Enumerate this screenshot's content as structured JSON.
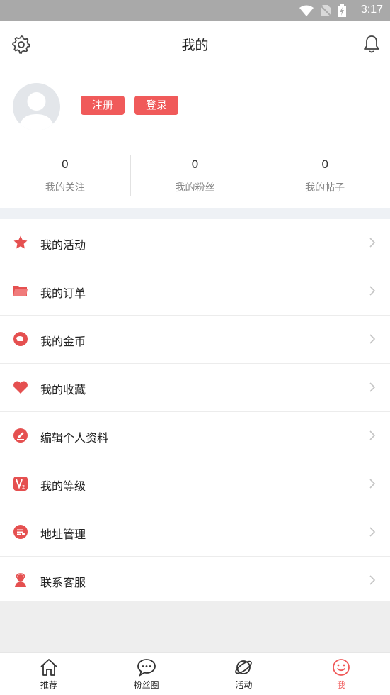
{
  "status_bar": {
    "time": "3:17"
  },
  "header": {
    "title": "我的"
  },
  "profile": {
    "register_label": "注册",
    "login_label": "登录"
  },
  "stats": [
    {
      "value": "0",
      "label": "我的关注"
    },
    {
      "value": "0",
      "label": "我的粉丝"
    },
    {
      "value": "0",
      "label": "我的帖子"
    }
  ],
  "menu": [
    {
      "label": "我的活动",
      "icon": "star-icon"
    },
    {
      "label": "我的订单",
      "icon": "folder-icon"
    },
    {
      "label": "我的金币",
      "icon": "coin-icon"
    },
    {
      "label": "我的收藏",
      "icon": "heart-icon"
    },
    {
      "label": "编辑个人资料",
      "icon": "edit-icon"
    },
    {
      "label": "我的等级",
      "icon": "level-icon"
    },
    {
      "label": "地址管理",
      "icon": "address-icon"
    },
    {
      "label": "联系客服",
      "icon": "customer-service-icon"
    }
  ],
  "tabs": [
    {
      "label": "推荐",
      "icon": "home-icon"
    },
    {
      "label": "粉丝圈",
      "icon": "chat-bubble-icon"
    },
    {
      "label": "活动",
      "icon": "planet-icon"
    },
    {
      "label": "我",
      "icon": "smile-icon",
      "active": true
    }
  ],
  "colors": {
    "accent": "#f05a5a",
    "status_bar": "#a9a9a9",
    "band": "#eef1f5"
  }
}
